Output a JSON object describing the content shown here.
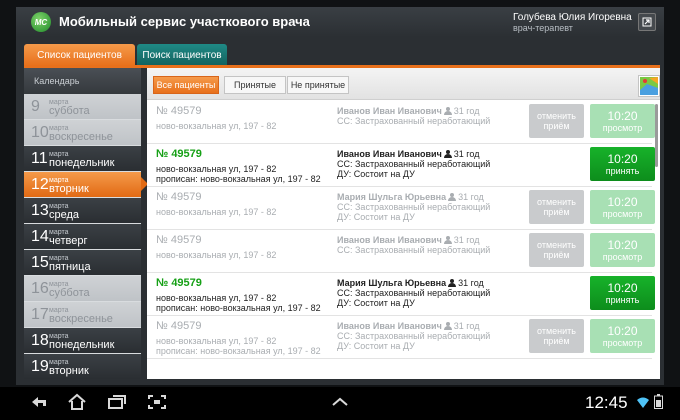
{
  "header": {
    "logo_text": "MC",
    "title": "Мобильный сервис участкового врача",
    "user_name": "Голубева Юлия Игоревна",
    "user_role": "врач-терапевт",
    "exit_icon": "exit-arrow-icon"
  },
  "tabs": {
    "patients_list": "Список пациентов",
    "patient_search": "Поиск пациентов"
  },
  "calendar": {
    "title": "Календарь",
    "days": [
      {
        "num": "9",
        "month": "марта",
        "weekday": "суббота",
        "state": "past"
      },
      {
        "num": "10",
        "month": "марта",
        "weekday": "воскресенье",
        "state": "past"
      },
      {
        "num": "11",
        "month": "марта",
        "weekday": "понедельник",
        "state": "future"
      },
      {
        "num": "12",
        "month": "марта",
        "weekday": "вторник",
        "state": "selected"
      },
      {
        "num": "13",
        "month": "марта",
        "weekday": "среда",
        "state": "future"
      },
      {
        "num": "14",
        "month": "марта",
        "weekday": "четверг",
        "state": "future"
      },
      {
        "num": "15",
        "month": "марта",
        "weekday": "пятница",
        "state": "future"
      },
      {
        "num": "16",
        "month": "марта",
        "weekday": "суббота",
        "state": "past"
      },
      {
        "num": "17",
        "month": "марта",
        "weekday": "воскресенье",
        "state": "past"
      },
      {
        "num": "18",
        "month": "марта",
        "weekday": "понедельник",
        "state": "future"
      },
      {
        "num": "19",
        "month": "марта",
        "weekday": "вторник",
        "state": "future"
      }
    ]
  },
  "filters": {
    "all": "Все пациенты",
    "accepted": "Принятые",
    "not_accepted": "Не принятые"
  },
  "patients": [
    {
      "number": "№ 49579",
      "address": "ново-вокзальная ул, 197 - 82",
      "reg": "",
      "name": "Иванов Иван Иванович",
      "age": "31 год",
      "ss": "СС: Застрахованный неработающий",
      "du": "",
      "cancel": "отменить приём",
      "time": "10:20",
      "action": "просмотр",
      "active": false
    },
    {
      "number": "№ 49579",
      "address": "ново-вокзальная ул, 197 - 82",
      "reg": "прописан: ново-вокзальная ул, 197 - 82",
      "name": "Иванов Иван Иванович",
      "age": "31 год",
      "ss": "СС: Застрахованный неработающий",
      "du": "ДУ: Состоит на ДУ",
      "cancel": "",
      "time": "10:20",
      "action": "принять",
      "active": true
    },
    {
      "number": "№ 49579",
      "address": "ново-вокзальная ул, 197 - 82",
      "reg": "",
      "name": "Мария Шульга Юрьевна",
      "age": "31 год",
      "ss": "СС: Застрахованный неработающий",
      "du": "ДУ: Состоит на ДУ",
      "cancel": "отменить приём",
      "time": "10:20",
      "action": "просмотр",
      "active": false
    },
    {
      "number": "№ 49579",
      "address": "ново-вокзальная ул, 197 - 82",
      "reg": "",
      "name": "Иванов Иван Иванович",
      "age": "31 год",
      "ss": "СС: Застрахованный неработающий",
      "du": "",
      "cancel": "отменить приём",
      "time": "10:20",
      "action": "просмотр",
      "active": false
    },
    {
      "number": "№ 49579",
      "address": "ново-вокзальная ул, 197 - 82",
      "reg": "прописан: ново-вокзальная ул, 197 - 82",
      "name": "Мария Шульга Юрьевна",
      "age": "31 год",
      "ss": "СС: Застрахованный неработающий",
      "du": "ДУ: Состоит на ДУ",
      "cancel": "",
      "time": "10:20",
      "action": "принять",
      "active": true
    },
    {
      "number": "№ 49579",
      "address": "ново-вокзальная ул, 197 - 82",
      "reg": "прописан: ново-вокзальная ул, 197 - 82",
      "name": "Иванов Иван Иванович",
      "age": "31 год",
      "ss": "СС: Застрахованный неработающий",
      "du": "ДУ: Состоит на ДУ",
      "cancel": "отменить приём",
      "time": "10:20",
      "action": "просмотр",
      "active": false
    }
  ],
  "navbar": {
    "clock": "12:45",
    "icons": [
      "back-icon",
      "home-icon",
      "recent-apps-icon",
      "screenshot-icon",
      "menu-up-icon",
      "wifi-icon",
      "battery-icon"
    ]
  },
  "colors": {
    "accent": "#e8701b",
    "teal_tab": "#13615d",
    "accept_green": "#0d8d1c",
    "view_green_light": "#a8e0b4"
  }
}
